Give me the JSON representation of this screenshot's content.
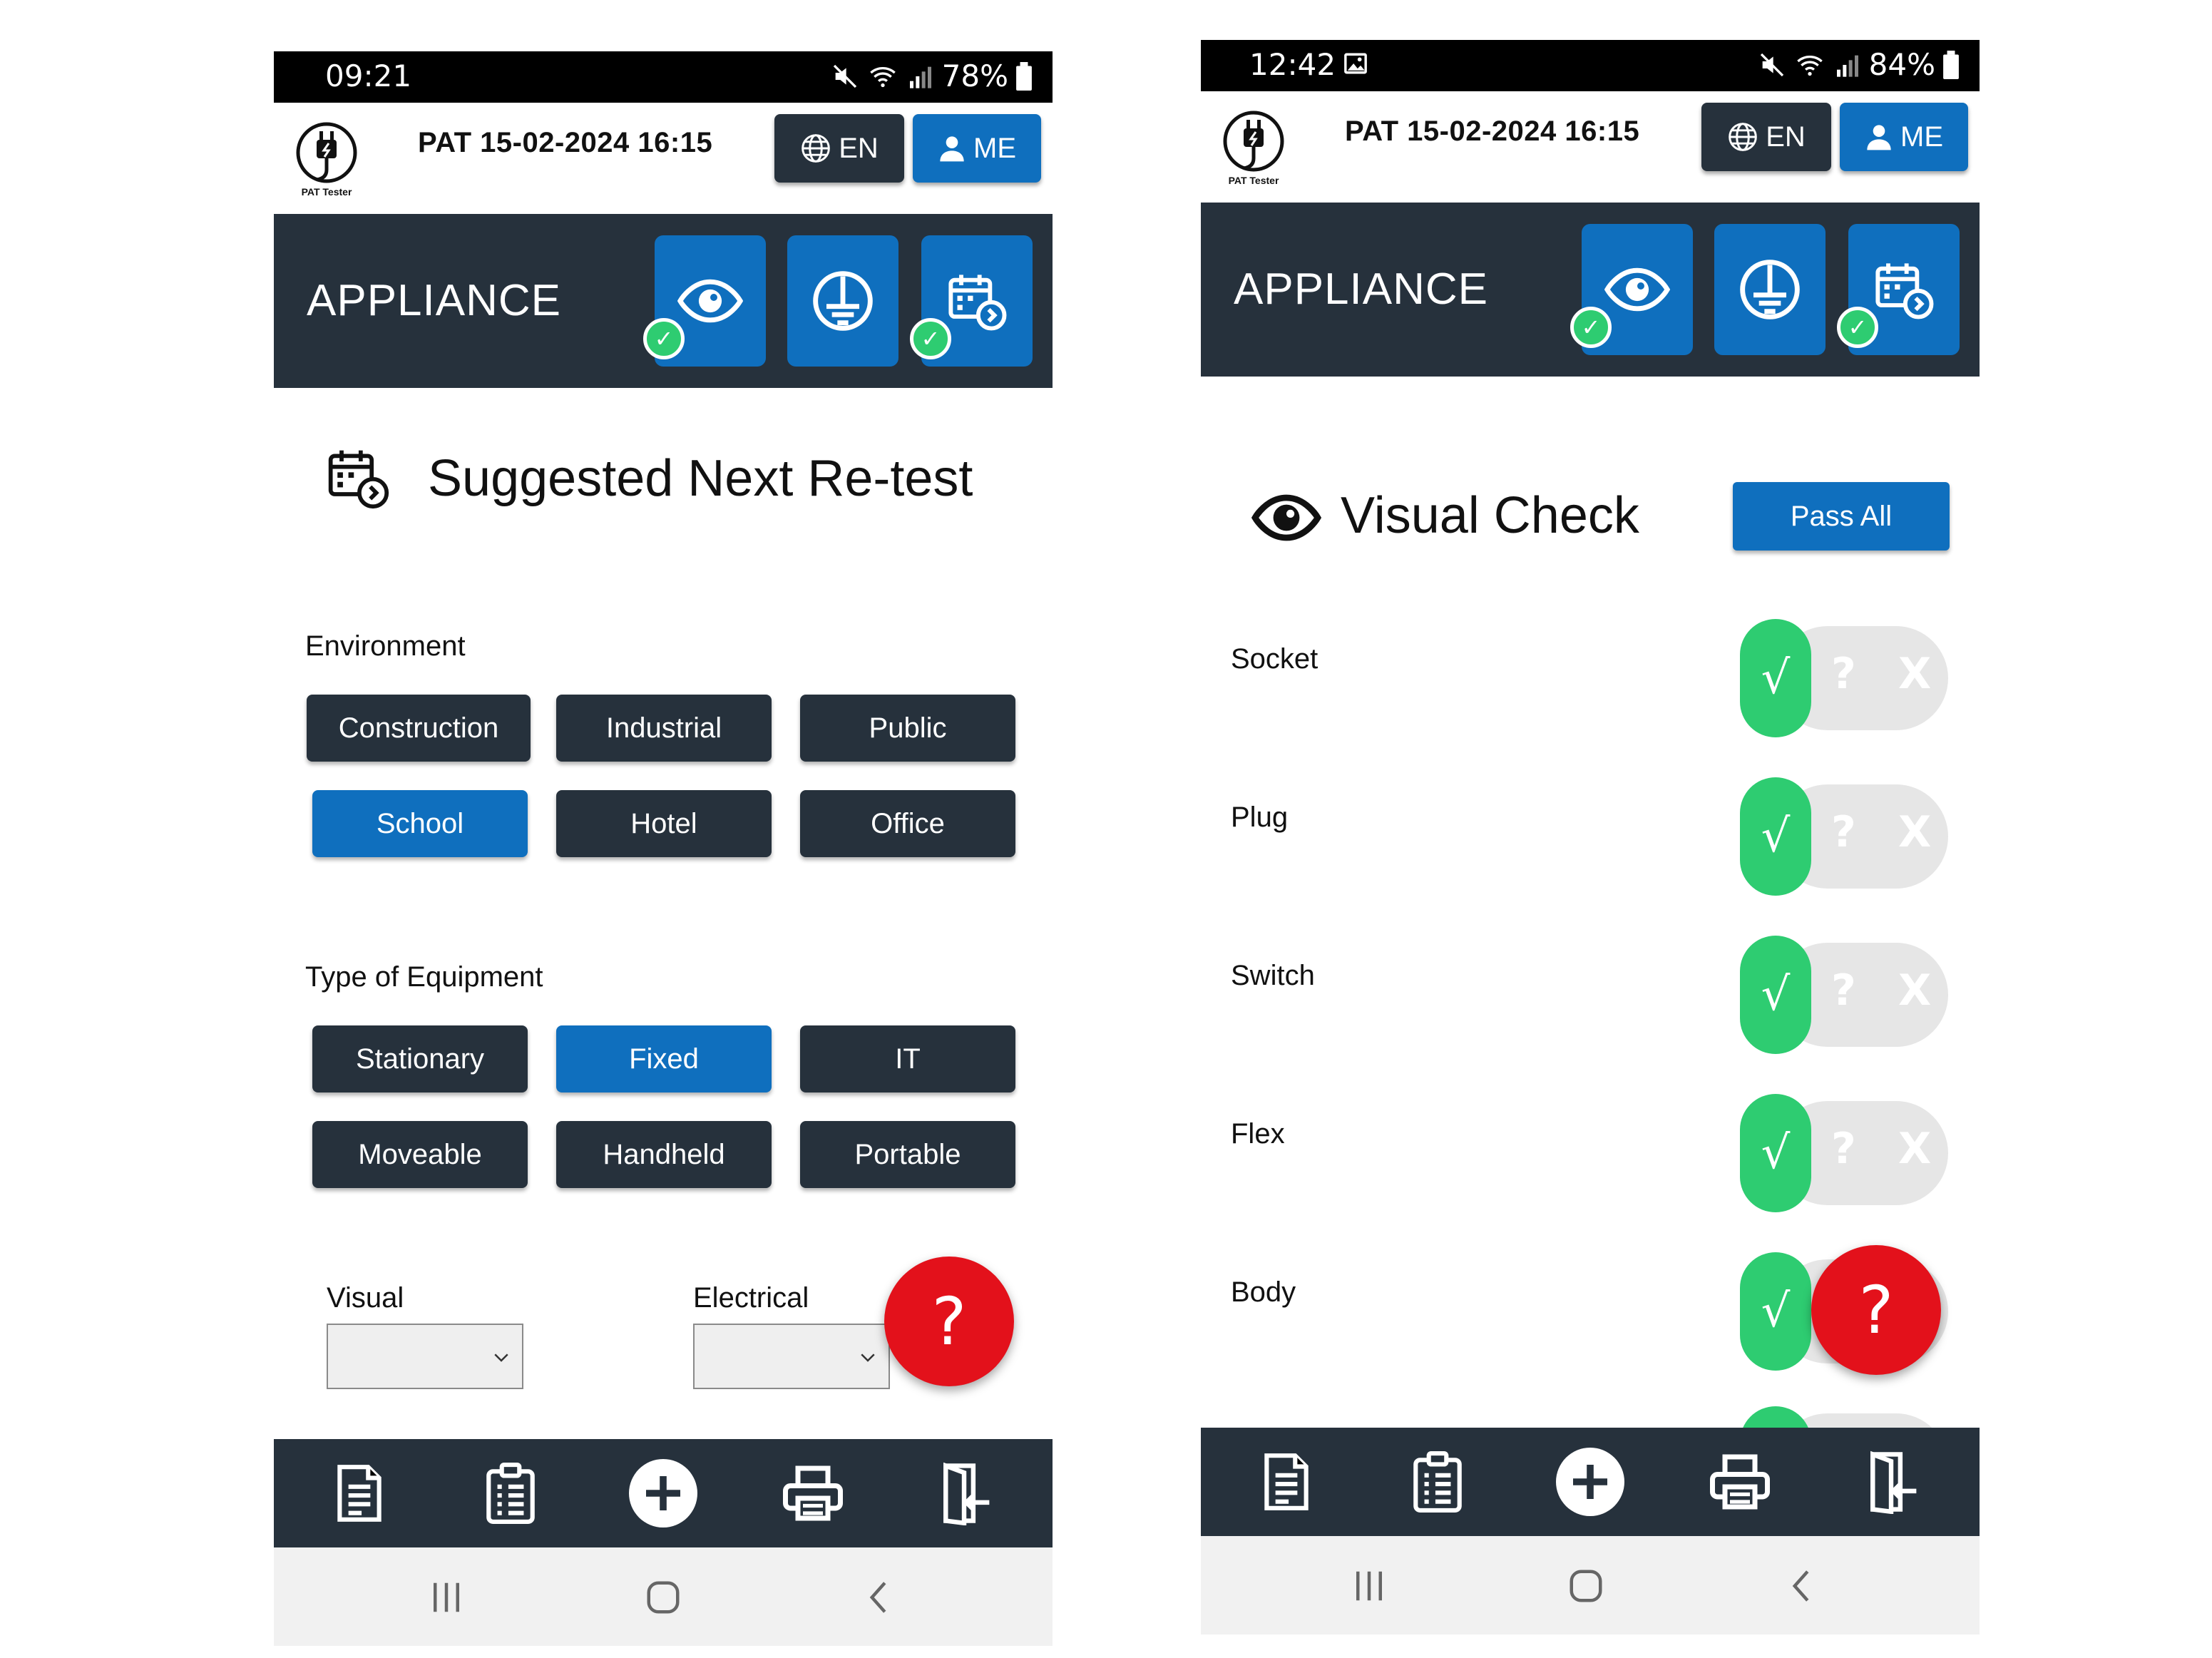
{
  "left_screen": {
    "status": {
      "time": "09:21",
      "battery": "78%"
    },
    "header": {
      "title": "PAT 15-02-2024 16:15",
      "lang_label": "EN",
      "user_label": "ME",
      "logo_text": "PAT Tester"
    },
    "band": {
      "title": "APPLIANCE",
      "tiles": [
        "eye-icon",
        "earth-icon",
        "calendar-icon"
      ]
    },
    "section_title": "Suggested Next Re-test",
    "environment": {
      "label": "Environment",
      "options": [
        "Construction",
        "Industrial",
        "Public",
        "School",
        "Hotel",
        "Office"
      ],
      "selected": "School"
    },
    "equipment": {
      "label": "Type of Equipment",
      "options": [
        "Stationary",
        "Fixed",
        "IT",
        "Moveable",
        "Handheld",
        "Portable"
      ],
      "selected": "Fixed"
    },
    "intervals": {
      "visual_label": "Visual",
      "electrical_label": "Electrical",
      "visual_value": "",
      "electrical_value": ""
    },
    "help": "?",
    "nav_icons": [
      "report-icon",
      "clipboard-icon",
      "add-icon",
      "printer-icon",
      "exit-icon"
    ]
  },
  "right_screen": {
    "status": {
      "time": "12:42",
      "battery": "84%"
    },
    "header": {
      "title": "PAT 15-02-2024 16:15",
      "lang_label": "EN",
      "user_label": "ME",
      "logo_text": "PAT Tester"
    },
    "band": {
      "title": "APPLIANCE"
    },
    "section_title": "Visual Check",
    "pass_all": "Pass All",
    "checks": [
      {
        "label": "Socket",
        "state": "pass"
      },
      {
        "label": "Plug",
        "state": "pass"
      },
      {
        "label": "Switch",
        "state": "pass"
      },
      {
        "label": "Flex",
        "state": "pass"
      },
      {
        "label": "Body",
        "state": "pass"
      }
    ],
    "toggle_symbols": {
      "pass": "√",
      "unknown": "?",
      "fail": "X"
    },
    "help": "?"
  },
  "colors": {
    "navy": "#26313c",
    "blue": "#0f6fbe",
    "green": "#2ecc71",
    "red": "#e3111b"
  }
}
